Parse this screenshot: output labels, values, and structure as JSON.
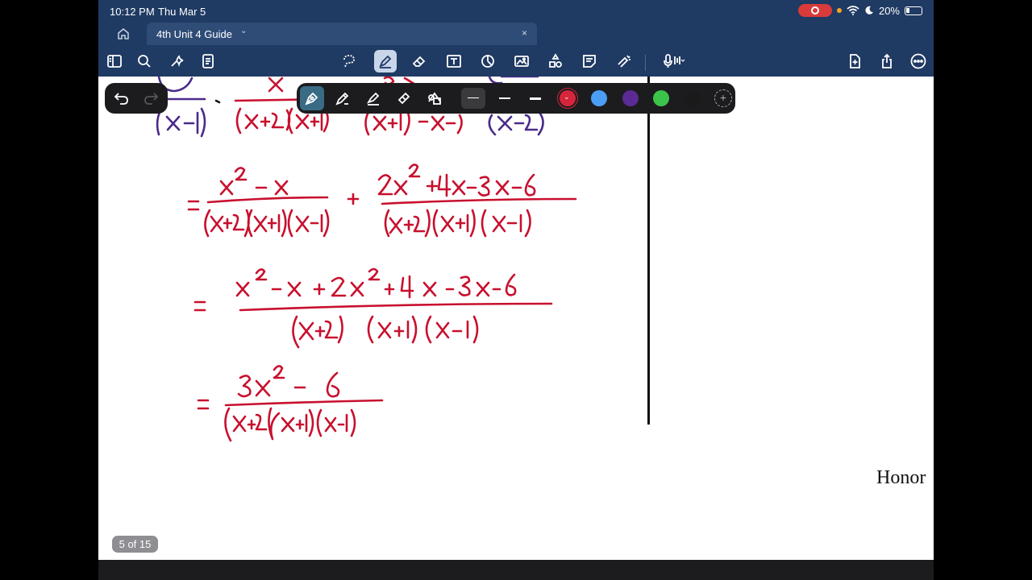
{
  "status": {
    "time": "10:12 PM",
    "date": "Thu Mar 5",
    "battery": "20%"
  },
  "tab": {
    "title": "4th Unit 4 Guide",
    "close": "×"
  },
  "toolbar": {
    "left": [
      "sidebar-icon",
      "search-icon",
      "ai-sparkle-icon",
      "outline-icon"
    ],
    "center": [
      "lasso-icon",
      "pen-icon",
      "eraser-icon",
      "text-icon",
      "shapes-icon",
      "image-icon",
      "elements-icon",
      "sticky-note-icon",
      "laser-pointer-icon",
      "microphone-icon"
    ],
    "right": [
      "add-page-icon",
      "share-icon",
      "more-icon"
    ]
  },
  "pen_palette": {
    "selected_color": "#d6253a",
    "colors": [
      "#d6253a",
      "#4a9ff5",
      "#5b2a95",
      "#3cc34a",
      "#1a1a1a"
    ]
  },
  "page": {
    "indicator": "5 of 15",
    "margin_text": "Honor"
  }
}
